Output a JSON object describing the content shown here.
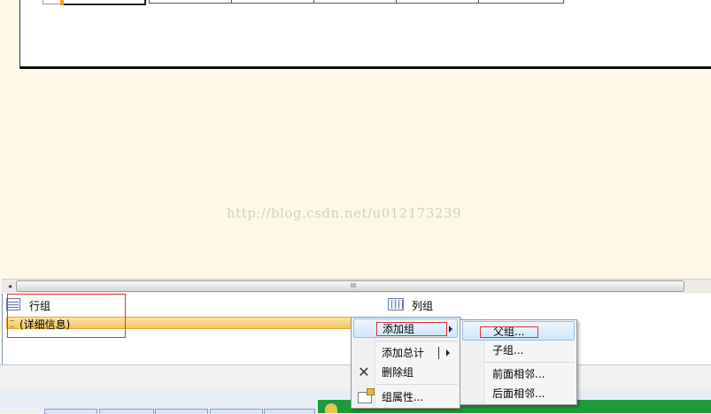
{
  "watermark": "http://blog.csdn.net/u012173239",
  "grouping_pane": {
    "row_groups_title": "行组",
    "column_groups_title": "列组",
    "details_group_label": "(详细信息)",
    "icons": {
      "row_groups": "row-groups-icon",
      "column_groups": "column-groups-icon"
    }
  },
  "scrollbar": {
    "grip": "III",
    "left_arrow": "◂"
  },
  "context_menu": {
    "items": [
      {
        "label": "添加组",
        "has_submenu": true,
        "highlighted": true
      },
      {
        "label": "添加总计",
        "has_submenu": true
      },
      {
        "label": "删除组",
        "icon": "delete-x-icon"
      },
      {
        "label": "组属性...",
        "icon": "properties-icon"
      }
    ]
  },
  "submenu": {
    "items": [
      {
        "label": "父组...",
        "highlighted": true
      },
      {
        "label": "子组..."
      },
      {
        "label": "前面相邻..."
      },
      {
        "label": "后面相邻..."
      }
    ]
  },
  "colors": {
    "highlight_border": "#8ec0ea",
    "annotation_red": "#e03030",
    "details_row": "#f5c45f",
    "surface": "#fdf9e6"
  }
}
